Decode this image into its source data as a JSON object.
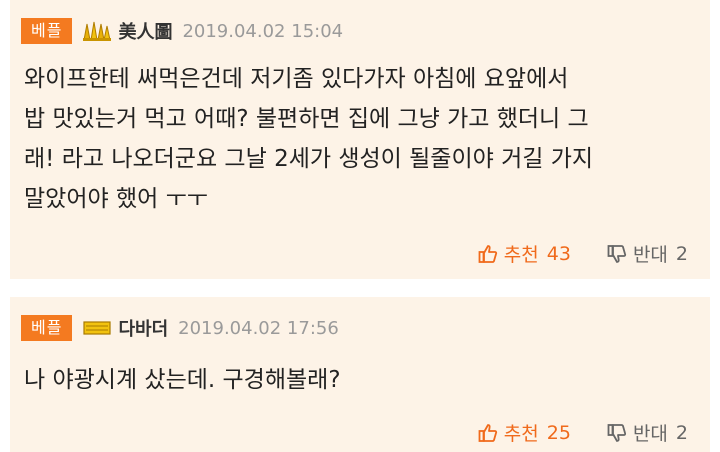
{
  "comments": [
    {
      "badge": "베플",
      "nickname": "美人圖",
      "rank_icon": "gold-crown-icon",
      "date": "2019.04.02 15:04",
      "lines": [
        "와이프한테 써먹은건데 저기좀 있다가자 아침에 요앞에서",
        "밥 맛있는거 먹고 어때? 불편하면 집에 그냥 가고 했더니 그",
        "래! 라고 나오더군요 그날 2세가 생성이 될줄이야 거길 가지",
        "말았어야 했어 ㅜㅜ"
      ],
      "upvote_label": "추천",
      "upvote_count": "43",
      "downvote_label": "반대",
      "downvote_count": "2"
    },
    {
      "badge": "베플",
      "nickname": "다바더",
      "rank_icon": "gold-bar-icon",
      "date": "2019.04.02 17:56",
      "lines": [
        "나 야광시계 샀는데. 구경해볼래?"
      ],
      "upvote_label": "추천",
      "upvote_count": "25",
      "downvote_label": "반대",
      "downvote_count": "2"
    }
  ],
  "colors": {
    "badge": "#f47a20",
    "card_bg": "#fdf3e7",
    "upvote": "#f06a1b"
  }
}
